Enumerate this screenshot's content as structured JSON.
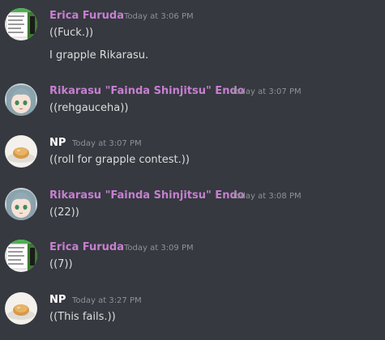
{
  "messages": [
    {
      "author": "Erica Furuda",
      "timestamp": "Today at 3:06 PM",
      "lines": [
        "((Fuck.))",
        "I grapple Rikarasu."
      ],
      "avatar_icon": "erica-avatar",
      "name_color": "#c67fd1"
    },
    {
      "author": "Rikarasu \"Fainda Shinjitsu\" Endo",
      "timestamp": "Today at 3:07 PM",
      "lines": [
        "((rehgauceha))"
      ],
      "avatar_icon": "rikarasu-avatar",
      "name_color": "#c67fd1"
    },
    {
      "author": "NP",
      "timestamp": "Today at 3:07 PM",
      "lines": [
        "((roll for grapple contest.))"
      ],
      "avatar_icon": "np-avatar",
      "name_color": "#ffffff"
    },
    {
      "author": "Rikarasu \"Fainda Shinjitsu\" Endo",
      "timestamp": "Today at 3:08 PM",
      "lines": [
        "((22))"
      ],
      "avatar_icon": "rikarasu-avatar",
      "name_color": "#c67fd1"
    },
    {
      "author": "Erica Furuda",
      "timestamp": "Today at 3:09 PM",
      "lines": [
        "((7))"
      ],
      "avatar_icon": "erica-avatar",
      "name_color": "#c67fd1"
    },
    {
      "author": "NP",
      "timestamp": "Today at 3:27 PM",
      "lines": [
        "((This fails.))"
      ],
      "avatar_icon": "np-avatar",
      "name_color": "#ffffff"
    }
  ],
  "colors": {
    "background": "#36393f",
    "text": "#dcddde",
    "timestamp": "#8e9297"
  }
}
